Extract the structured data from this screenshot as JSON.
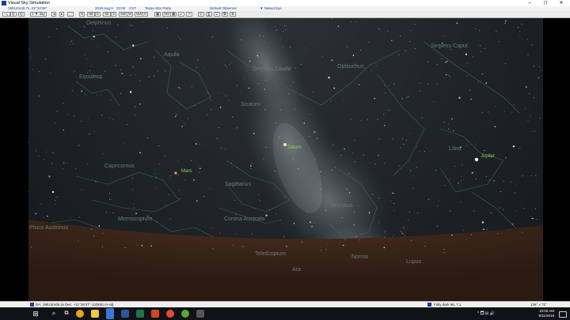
{
  "window": {
    "title": "Visual Sky Simulation",
    "minimize": "–",
    "maximize": "◻",
    "close": "✕"
  },
  "infobar": {
    "ra": "18h12m30.7s -22°34'36\"",
    "date": "2018 Aug 9",
    "time": "22:00",
    "tz": "CST",
    "site": "Texas Star Party",
    "observer": "Default Observer",
    "view": "▼ Naked Eye"
  },
  "toolbar": {
    "buttons": [
      "🔍",
      "Q",
      "Q",
      "1 ▼ day",
      "◂",
      "▸",
      "⬚",
      "N",
      "NE",
      "E",
      "SE",
      "S",
      "SW",
      "W",
      "NW",
      "H",
      "▦",
      "HM",
      "▦",
      "↙",
      "↗",
      "⊙",
      "⎙",
      "⎋",
      "❂",
      "⊕"
    ]
  },
  "constellations": [
    {
      "name": "Delphinus"
    },
    {
      "name": "Aquila"
    },
    {
      "name": "Equuleus"
    },
    {
      "name": "Serpens Cauda"
    },
    {
      "name": "Ophiuchus"
    },
    {
      "name": "Serpens Caput"
    },
    {
      "name": "Scutum"
    },
    {
      "name": "Libra"
    },
    {
      "name": "Capricornus"
    },
    {
      "name": "Sagittarius"
    },
    {
      "name": "Scorpius"
    },
    {
      "name": "Microscopium"
    },
    {
      "name": "Corona Australis"
    },
    {
      "name": "Piscis Austrinus"
    },
    {
      "name": "Telescopium"
    },
    {
      "name": "Norma"
    },
    {
      "name": "Lupus"
    },
    {
      "name": "Ara"
    }
  ],
  "planets": [
    {
      "name": "Saturn"
    },
    {
      "name": "Mars"
    },
    {
      "name": "Jupiter"
    }
  ],
  "status": {
    "coords": "RA: 19h12m05.2s  Dec: +11°26'37\" (J2000) m Adj",
    "sky_mode": "Fully dark ML 7.1",
    "fov": "136° x 72°"
  },
  "taskbar": {
    "tray_icons": "^ 🗖 ⊟ 🔊",
    "time": "10:00 AM",
    "date": "9/11/2018"
  },
  "colors": {
    "planet_label": "#7ed957",
    "constellation_label": "#6e7a80",
    "horizon": "#3a2418"
  }
}
